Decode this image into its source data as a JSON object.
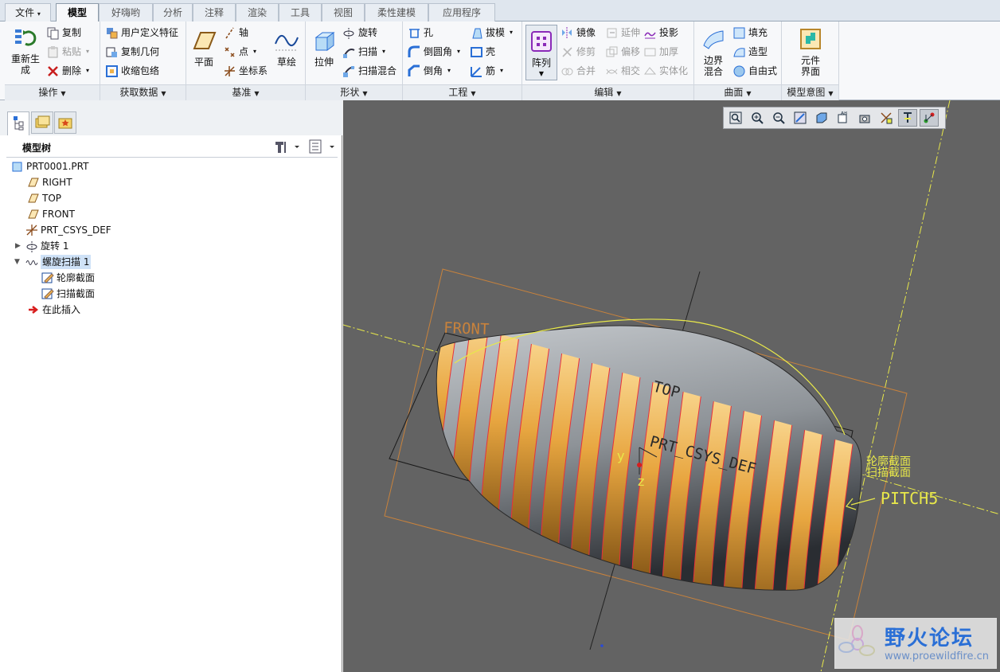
{
  "menu": {
    "tabs": [
      "文件",
      "模型",
      "好嗨哟",
      "分析",
      "注释",
      "渲染",
      "工具",
      "视图",
      "柔性建模",
      "应用程序"
    ],
    "active": "模型"
  },
  "ribbon": {
    "operations": {
      "footer": "操作",
      "regen": "重新生成",
      "copy": "复制",
      "paste": "粘贴",
      "delete": "删除"
    },
    "get_data": {
      "footer": "获取数据",
      "udf": "用户定义特征",
      "copy_geom": "复制几何",
      "shrinkwrap": "收缩包络"
    },
    "datum": {
      "footer": "基准",
      "plane": "平面",
      "axis": "轴",
      "point": "点",
      "csys": "坐标系",
      "sketch": "草绘"
    },
    "shapes": {
      "footer": "形状",
      "extrude": "拉伸",
      "revolve": "旋转",
      "sweep": "扫描",
      "swept_blend": "扫描混合"
    },
    "engineering": {
      "footer": "工程",
      "hole": "孔",
      "round": "倒圆角",
      "chamfer": "倒角",
      "draft": "拔模",
      "shell": "壳",
      "rib": "筋"
    },
    "editing": {
      "footer": "编辑",
      "pattern": "阵列",
      "mirror": "镜像",
      "trim": "修剪",
      "merge": "合并",
      "extend": "延伸",
      "offset": "偏移",
      "intersect": "相交",
      "project": "投影",
      "thicken": "加厚",
      "solidify": "实体化"
    },
    "surfaces": {
      "footer": "曲面",
      "boundary": "边界混合",
      "fill": "填充",
      "style": "造型",
      "freestyle": "自由式"
    },
    "model_intent": {
      "footer": "模型意图",
      "component": "元件界面"
    }
  },
  "tree": {
    "title": "模型树",
    "items": [
      "PRT0001.PRT",
      "RIGHT",
      "TOP",
      "FRONT",
      "PRT_CSYS_DEF",
      "旋转 1",
      "螺旋扫描 1",
      "轮廓截面",
      "扫描截面",
      "在此插入"
    ]
  },
  "viewport": {
    "labels": {
      "front": "FRONT",
      "top": "TOP",
      "csys": "PRT_CSYS_DEF",
      "profile": "轮廓截面",
      "sweep_section": "扫描截面",
      "pitch": "PITCH5",
      "y": "y",
      "z": "z"
    },
    "colors": {
      "background": "#636363",
      "thread_gold": "#e8a640",
      "thread_grey": "#a9aeb4",
      "edge_red": "#e8313a",
      "label_yellow": "#e8e84a",
      "datum_orange": "#c8823c"
    }
  },
  "watermark": {
    "title": "野火论坛",
    "url": "www.proewildfire.cn"
  }
}
